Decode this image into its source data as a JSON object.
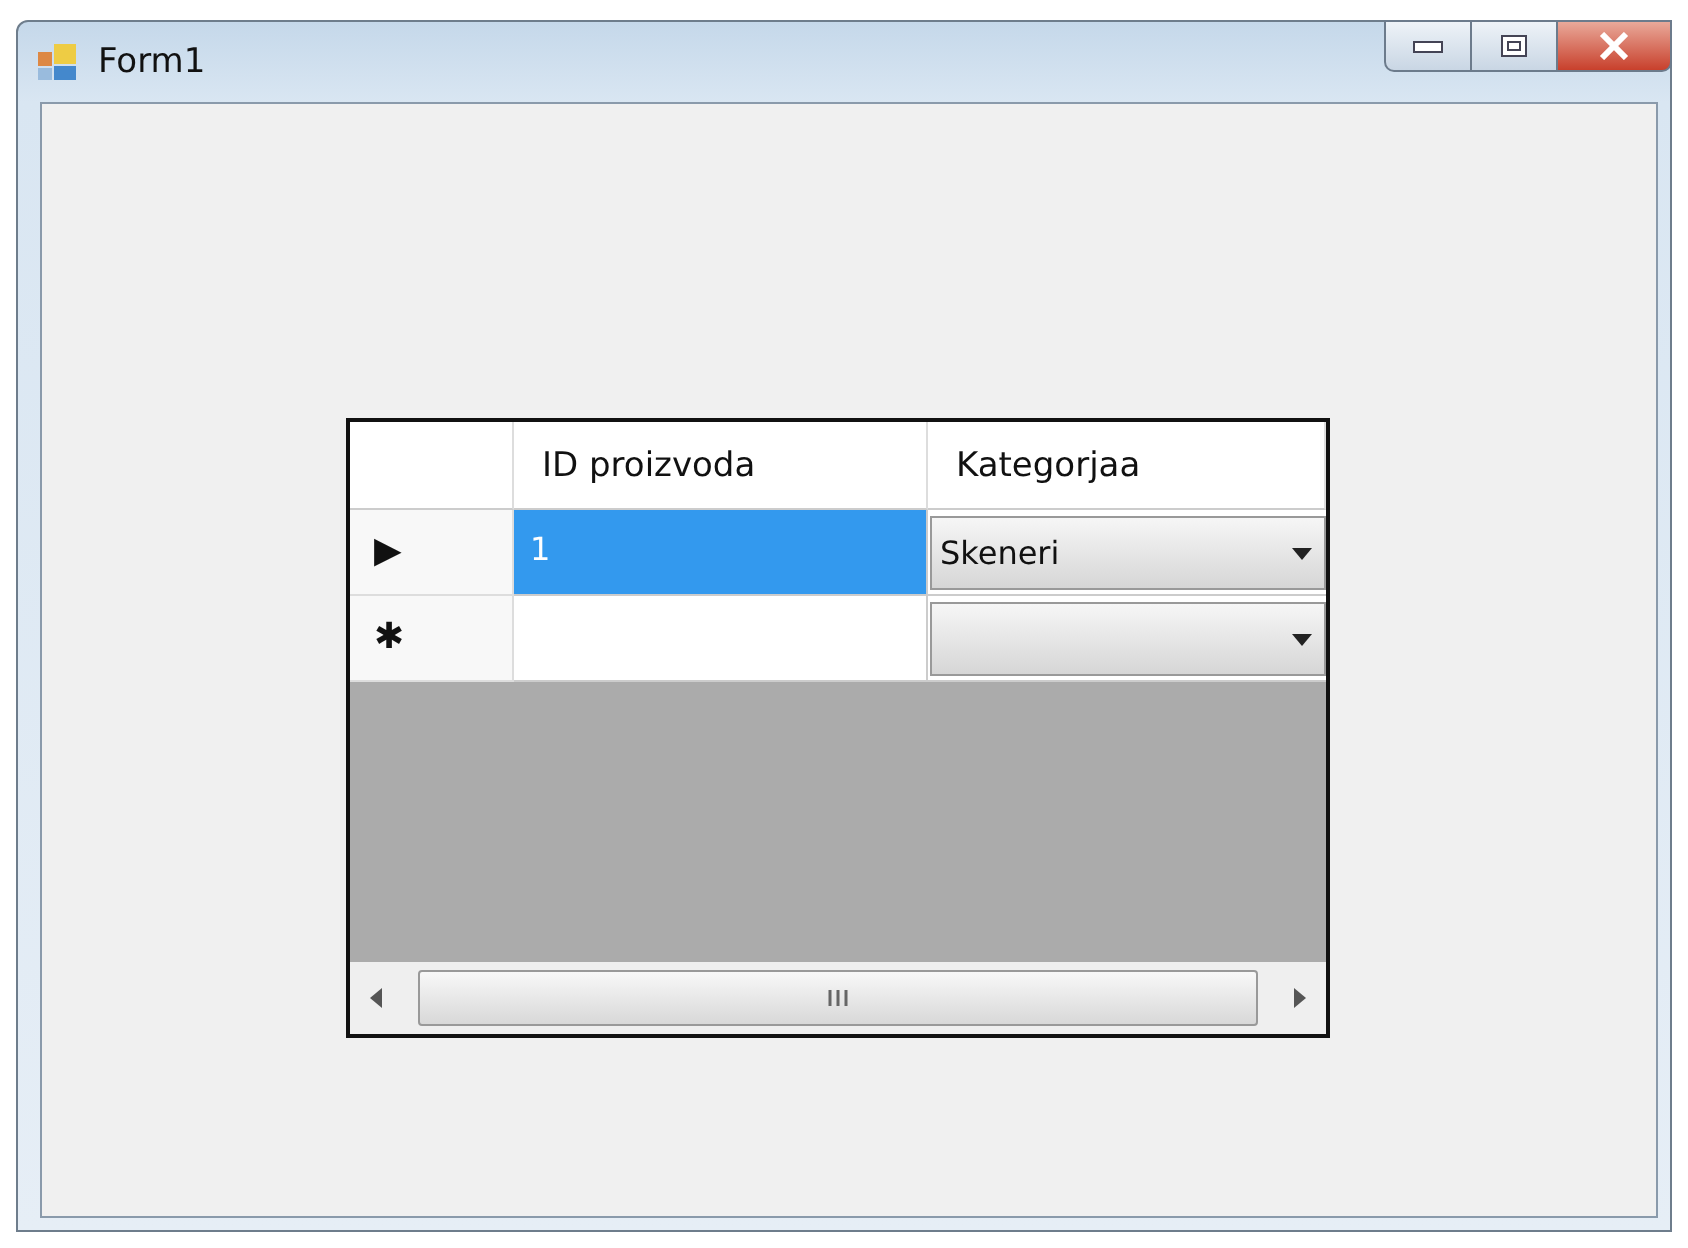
{
  "window": {
    "title": "Form1"
  },
  "grid": {
    "columns": [
      "ID proizvoda",
      "Kategorjaa"
    ],
    "rows": [
      {
        "marker": "▶",
        "selected": true,
        "id": "1",
        "category": "Skeneri"
      },
      {
        "marker": "✱",
        "selected": false,
        "id": "",
        "category": ""
      }
    ]
  }
}
